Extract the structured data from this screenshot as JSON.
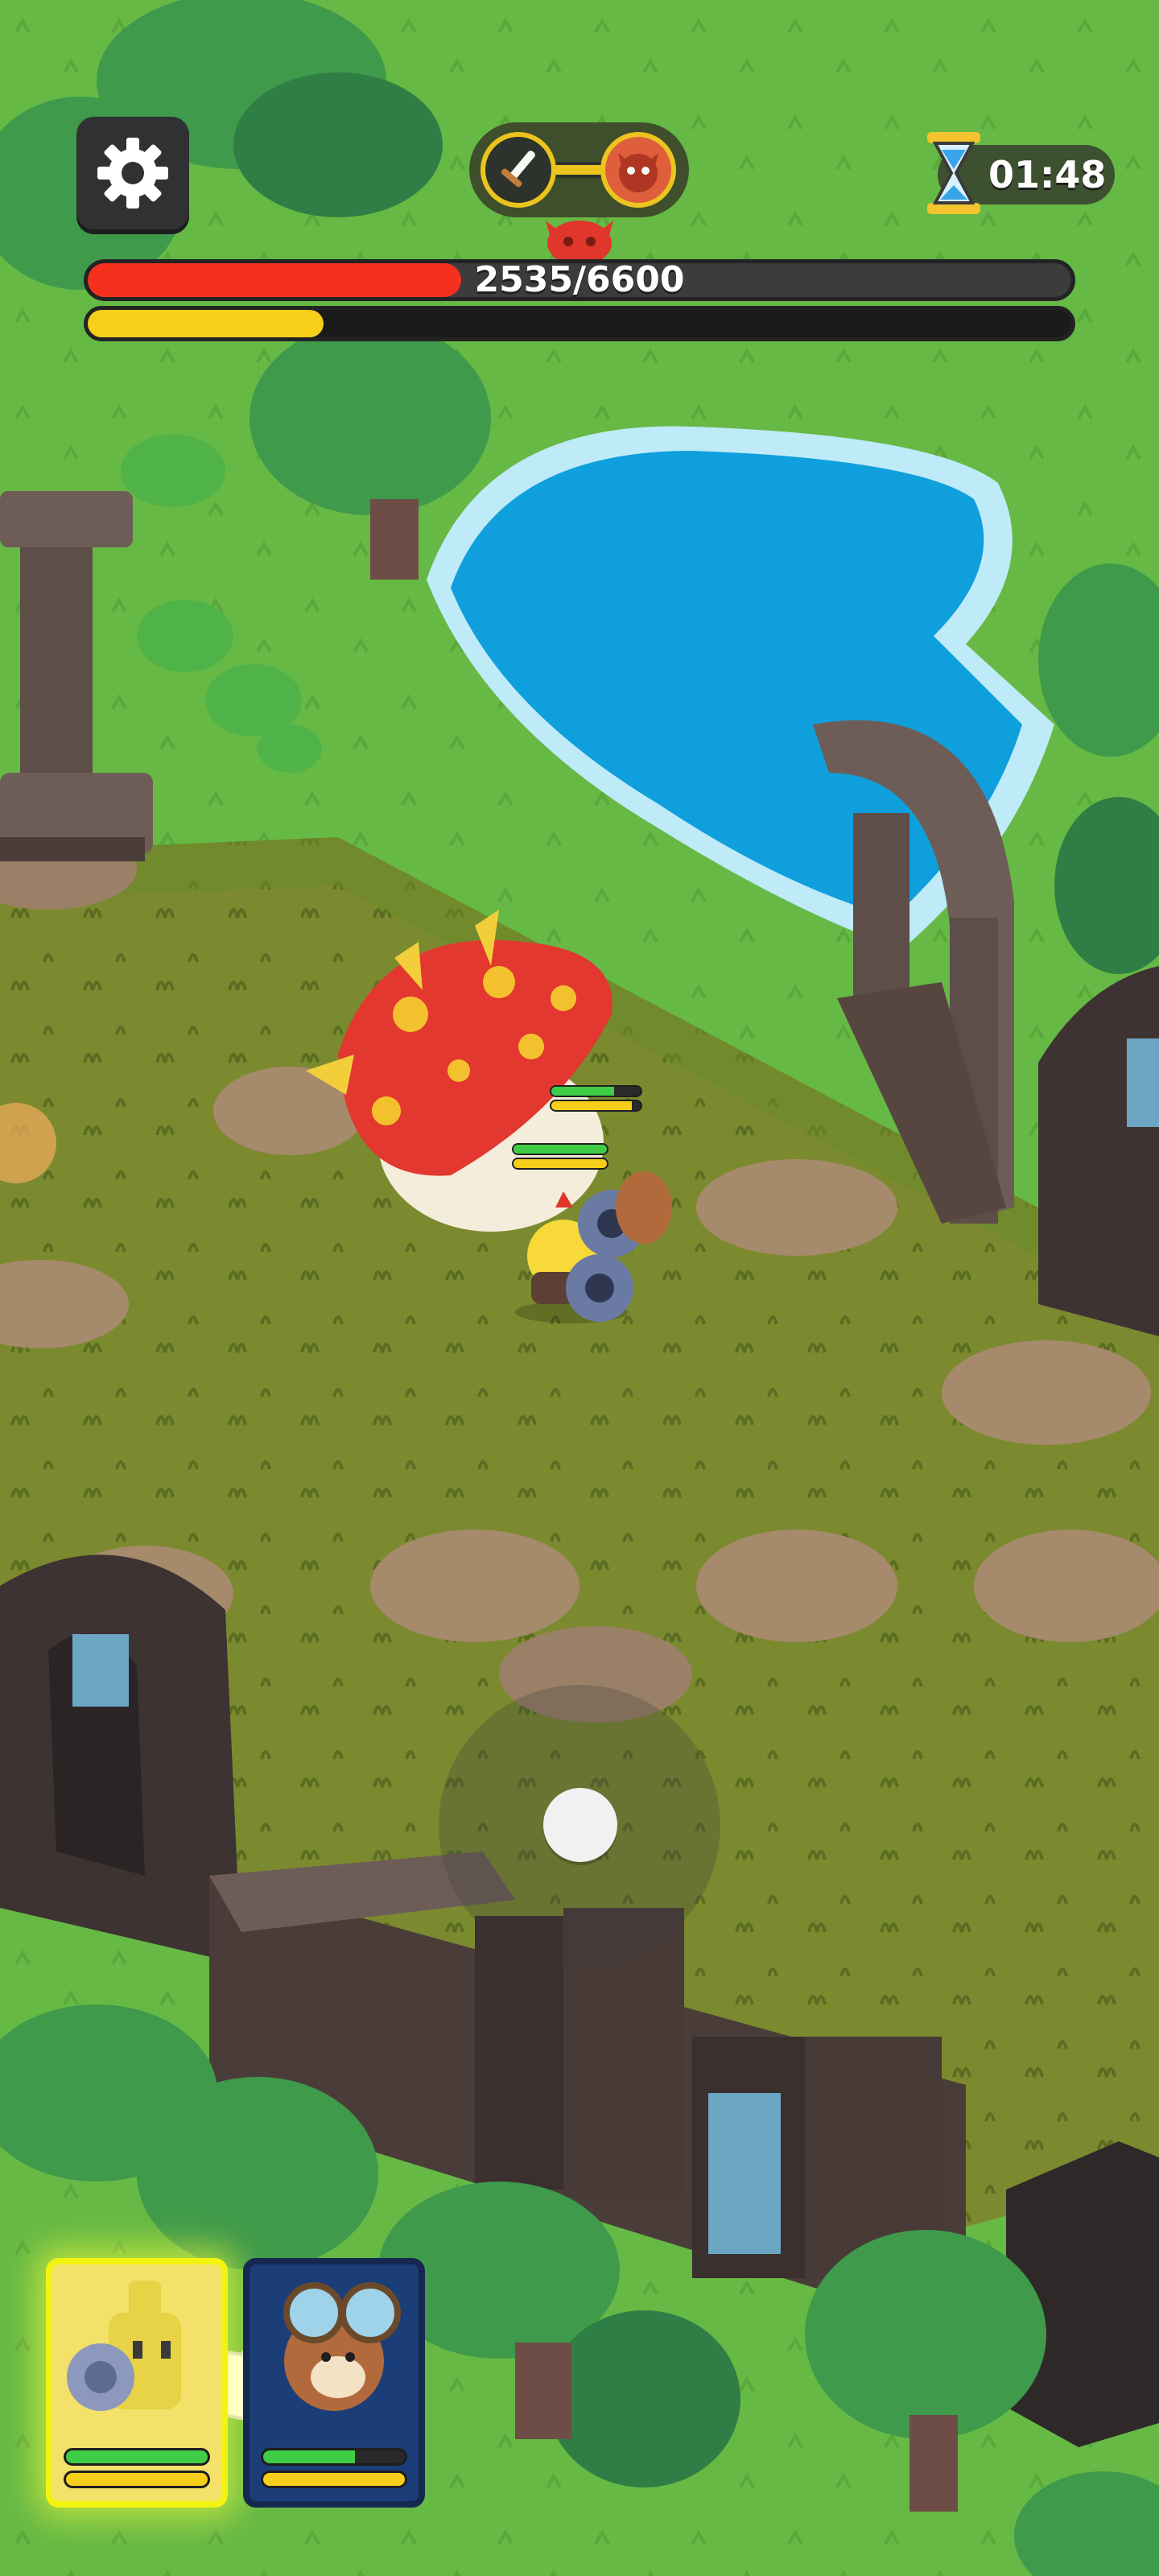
{
  "hud": {
    "settings_icon": "gear-icon",
    "mode_icons": [
      "sword-icon",
      "boss-face-icon"
    ],
    "timer": "01:48",
    "timer_icon": "hourglass-icon",
    "boss": {
      "hp_current": 2535,
      "hp_max": 6600,
      "hp_text": "2535/6600",
      "hp_fraction": 0.38,
      "rage_fraction": 0.24
    }
  },
  "units": {
    "mushroom_boss": {
      "hp_fraction": 0.7,
      "energy_fraction": 0.9
    },
    "hero_chick": {
      "hp_fraction": 1.0,
      "energy_fraction": 1.0
    }
  },
  "hero_cards": [
    {
      "name": "chick-hero",
      "selected": true,
      "hp_fraction": 1.0,
      "energy_fraction": 1.0
    },
    {
      "name": "squirrel-hero",
      "selected": false,
      "hp_fraction": 0.65,
      "energy_fraction": 1.0
    }
  ],
  "tutorial_icon": "pointing-hand-icon",
  "colors": {
    "grass": "#66b945",
    "boss_hp": "#f4311e",
    "energy": "#f7cf1a",
    "water": "#0f9fdc",
    "card_highlight": "#f3f310"
  }
}
